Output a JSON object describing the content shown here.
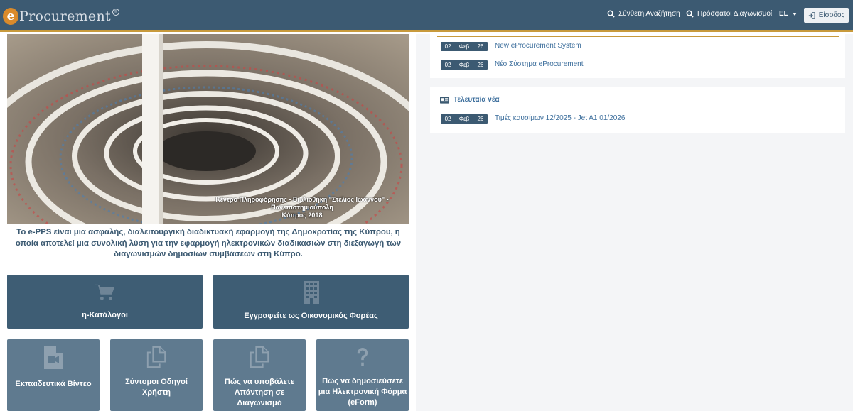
{
  "header": {
    "logo_text": "Procurement",
    "nav_advanced_search": "Σύνθετη Αναζήτηση",
    "nav_recent_tenders": "Πρόσφατοι Διαγωνισμοί",
    "language": "EL",
    "login_label": "Είσοδος"
  },
  "hero": {
    "caption_line1": "Κέντρο Πληροφόρησης - Βιβλιοθήκη \"Στέλιος Ιωάννου\" -",
    "caption_line2": "Πανεπιστημιούπολη",
    "caption_line3": "Κύπρος 2018"
  },
  "intro_text": "Το e-PPS είναι μια ασφαλής, διαλειτουργική διαδικτυακή εφαρμογή της Δημοκρατίας της Κύπρου, η οποία αποτελεί μια συνολική λύση για την εφαρμογή ηλεκτρονικών διαδικασιών στη διεξαγωγή των διαγωνισμών δημοσίων συμβάσεων στη Κύπρο.",
  "tiles_large": [
    {
      "label": "η-Κατάλογοι",
      "icon": "cart-icon"
    },
    {
      "label": "Εγγραφείτε ως Οικονομικός Φορέας",
      "icon": "building-icon"
    }
  ],
  "tiles_small": [
    {
      "label": "Εκπαιδευτικά Βίντεο",
      "icon": "video-file-icon"
    },
    {
      "label": "Σύντομοι Οδηγοί Χρήστη",
      "icon": "copy-icon"
    },
    {
      "label": "Πώς να υποβάλετε Απάντηση σε Διαγωνισμό",
      "icon": "copy-icon"
    },
    {
      "label": "Πώς να δημοσιεύσετε μια Ηλεκτρονική Φόρμα (eForm)",
      "icon": "question-icon"
    }
  ],
  "announcements": {
    "items": [
      {
        "day": "02",
        "month": "Φεβ",
        "year": "26",
        "title": "New eProcurement System"
      },
      {
        "day": "02",
        "month": "Φεβ",
        "year": "26",
        "title": "Νέο Σύστημα eProcurement"
      }
    ]
  },
  "latest_news": {
    "title": "Τελευταία νέα",
    "items": [
      {
        "day": "02",
        "month": "Φεβ",
        "year": "26",
        "title": "Τιμές καυσίμων 12/2025 - Jet A1 01/2026"
      }
    ]
  }
}
